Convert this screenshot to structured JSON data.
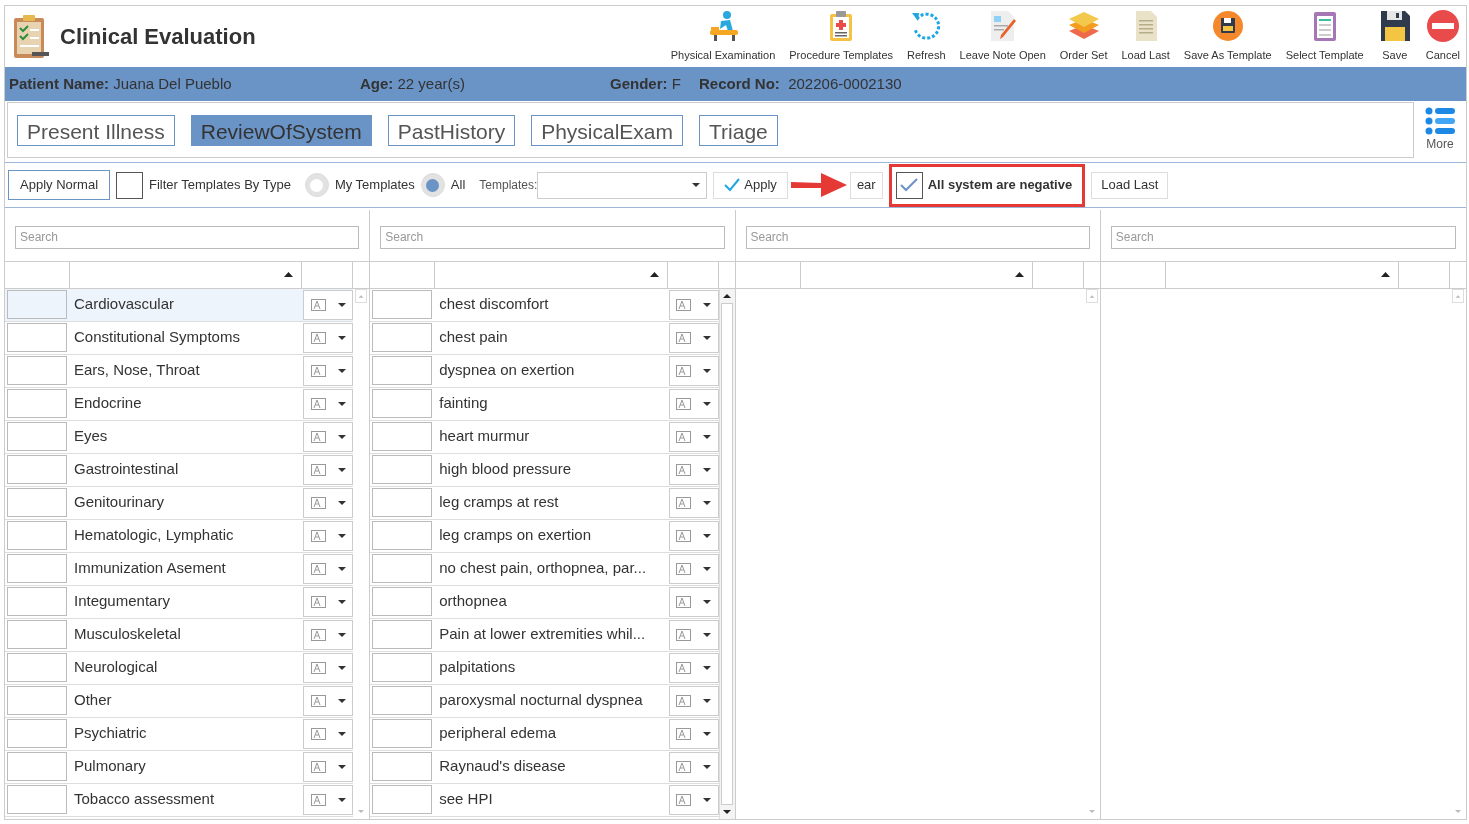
{
  "header": {
    "title": "Clinical Evaluation",
    "toolbar": [
      {
        "label": "Physical Examination",
        "kind": "exam"
      },
      {
        "label": "Procedure Templates",
        "kind": "procedure"
      },
      {
        "label": "Refresh",
        "kind": "refresh"
      },
      {
        "label": "Leave Note Open",
        "kind": "note"
      },
      {
        "label": "Order Set",
        "kind": "order"
      },
      {
        "label": "Load Last",
        "kind": "load"
      },
      {
        "label": "Save As Template",
        "kind": "save_template"
      },
      {
        "label": "Select Template",
        "kind": "select_template"
      },
      {
        "label": "Save",
        "kind": "save"
      },
      {
        "label": "Cancel",
        "kind": "cancel"
      }
    ]
  },
  "patient": {
    "name_label": "Patient Name:",
    "name": "Juana Del Pueblo",
    "age_label": "Age:",
    "age": "22 year(s)",
    "gender_label": "Gender:",
    "gender": "F",
    "record_label": "Record No:",
    "record": "202206-0002130"
  },
  "tabs": [
    {
      "label": "Present Illness",
      "selected": false
    },
    {
      "label": "ReviewOfSystem",
      "selected": true
    },
    {
      "label": "PastHistory",
      "selected": false
    },
    {
      "label": "PhysicalExam",
      "selected": false
    },
    {
      "label": "Triage",
      "selected": false
    }
  ],
  "more": "More",
  "filter_bar": {
    "apply_normal": "Apply Normal",
    "filter_by_type": {
      "label": "Filter Templates By Type",
      "checked": false
    },
    "radios": [
      {
        "label": "My Templates",
        "selected": false
      },
      {
        "label": "All",
        "selected": true
      }
    ],
    "templates_label": "Templates:",
    "apply": "Apply",
    "clear": "ear",
    "all_negative": {
      "label": "All system are negative",
      "checked": true
    },
    "load_last": "Load Last"
  },
  "panels": [
    {
      "search_placeholder": "Search",
      "rows": [
        {
          "label": "Cardiovascular",
          "selected": true
        },
        {
          "label": "Constitutional Symptoms",
          "selected": false
        },
        {
          "label": "Ears, Nose, Throat",
          "selected": false
        },
        {
          "label": "Endocrine",
          "selected": false
        },
        {
          "label": "Eyes",
          "selected": false
        },
        {
          "label": "Gastrointestinal",
          "selected": false
        },
        {
          "label": "Genitourinary",
          "selected": false
        },
        {
          "label": "Hematologic, Lymphatic",
          "selected": false
        },
        {
          "label": "Immunization Asement",
          "selected": false
        },
        {
          "label": "Integumentary",
          "selected": false
        },
        {
          "label": "Musculoskeletal",
          "selected": false
        },
        {
          "label": "Neurological",
          "selected": false
        },
        {
          "label": "Other",
          "selected": false
        },
        {
          "label": "Psychiatric",
          "selected": false
        },
        {
          "label": "Pulmonary",
          "selected": false
        },
        {
          "label": "Tobacco assessment",
          "selected": false
        }
      ]
    },
    {
      "search_placeholder": "Search",
      "rows": [
        {
          "label": "chest discomfort",
          "selected": false
        },
        {
          "label": "chest pain",
          "selected": false
        },
        {
          "label": "dyspnea on exertion",
          "selected": false
        },
        {
          "label": "fainting",
          "selected": false
        },
        {
          "label": "heart murmur",
          "selected": false
        },
        {
          "label": "high blood pressure",
          "selected": false
        },
        {
          "label": "leg cramps at rest",
          "selected": false
        },
        {
          "label": "leg cramps on exertion",
          "selected": false
        },
        {
          "label": "no chest pain, orthopnea, par...",
          "selected": false
        },
        {
          "label": "orthopnea",
          "selected": false
        },
        {
          "label": "Pain at lower extremities whil...",
          "selected": false
        },
        {
          "label": "palpitations",
          "selected": false
        },
        {
          "label": "paroxysmal nocturnal dyspnea",
          "selected": false
        },
        {
          "label": "peripheral edema",
          "selected": false
        },
        {
          "label": "Raynaud's disease",
          "selected": false
        },
        {
          "label": "see HPI",
          "selected": false
        }
      ]
    },
    {
      "search_placeholder": "Search"
    },
    {
      "search_placeholder": "Search"
    }
  ]
}
